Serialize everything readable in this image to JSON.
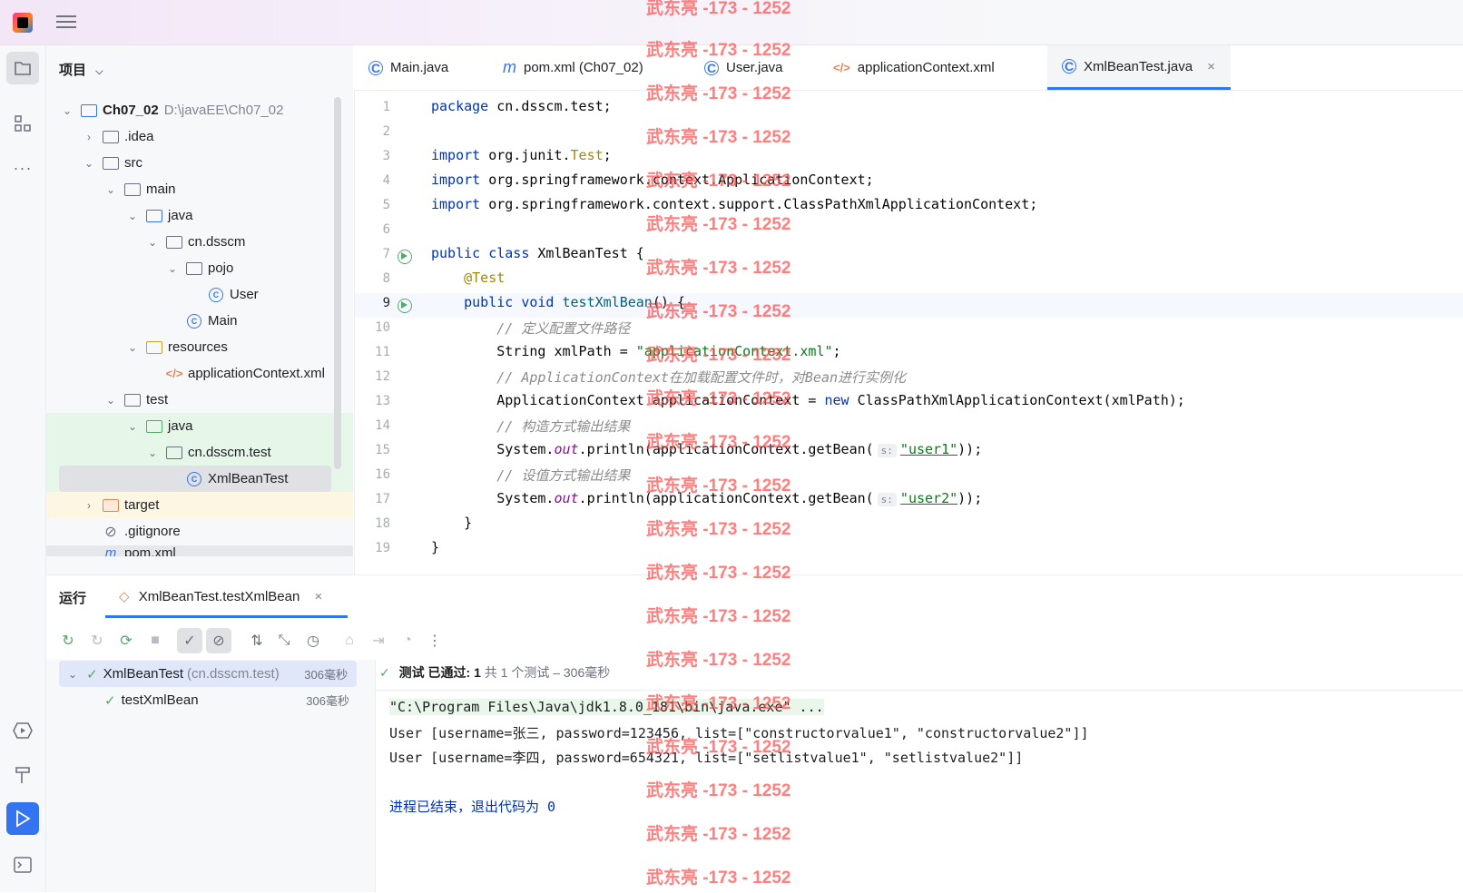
{
  "project_panel": {
    "title": "项目"
  },
  "tree": [
    {
      "label": "Ch07_02",
      "path": "D:\\javaEE\\Ch07_02"
    },
    {
      "label": ".idea"
    },
    {
      "label": "src"
    },
    {
      "label": "main"
    },
    {
      "label": "java"
    },
    {
      "label": "cn.dsscm"
    },
    {
      "label": "pojo"
    },
    {
      "label": "User"
    },
    {
      "label": "Main"
    },
    {
      "label": "resources"
    },
    {
      "label": "applicationContext.xml"
    },
    {
      "label": "test"
    },
    {
      "label": "java"
    },
    {
      "label": "cn.dsscm.test"
    },
    {
      "label": "XmlBeanTest"
    },
    {
      "label": "target"
    },
    {
      "label": ".gitignore"
    },
    {
      "label": "pom.xml"
    }
  ],
  "tabs": [
    "Main.java",
    "pom.xml (Ch07_02)",
    "User.java",
    "applicationContext.xml",
    "XmlBeanTest.java"
  ],
  "editor": {
    "line_numbers": [
      "1",
      "2",
      "3",
      "4",
      "5",
      "6",
      "7",
      "8",
      "9",
      "10",
      "11",
      "12",
      "13",
      "14",
      "15",
      "16",
      "17",
      "18",
      "19"
    ],
    "param_hint": "s:",
    "lines": {
      "l1_kw": "package",
      "l1": " cn.dsscm.test;",
      "l3_kw": "import",
      "l3": " org.junit.",
      "l3_an": "Test",
      "l3_end": ";",
      "l4_kw": "import",
      "l4": " org.springframework.context.ApplicationContext;",
      "l5_kw": "import",
      "l5": " org.springframework.context.support.ClassPathXmlApplicationContext;",
      "l7_kw": "public class",
      "l7": " XmlBeanTest {",
      "l8": "    @Test",
      "l9_kw": "    public void",
      "l9_fn": " testXmlBean",
      "l9": "() {",
      "l10": "        // 定义配置文件路径",
      "l11": "        String xmlPath = ",
      "l11_str": "\"applicationContext.xml\"",
      "l11_end": ";",
      "l12": "        // ApplicationContext在加载配置文件时，对Bean进行实例化",
      "l13": "        ApplicationContext applicationContext = ",
      "l13_kw": "new",
      "l13_end": " ClassPathXmlApplicationContext(xmlPath);",
      "l14": "        // 构造方式输出结果",
      "l15": "        System.",
      "l15_it": "out",
      "l15_mid": ".println(applicationContext.getBean(",
      "l15_str": "\"user1\"",
      "l15_end": "));",
      "l16": "        // 设值方式输出结果",
      "l17": "        System.",
      "l17_it": "out",
      "l17_mid": ".println(applicationContext.getBean(",
      "l17_str": "\"user2\"",
      "l17_end": "));",
      "l18": "    }",
      "l19": "}"
    }
  },
  "run": {
    "header": "运行",
    "tab": "XmlBeanTest.testXmlBean",
    "tests": [
      {
        "name": "XmlBeanTest",
        "pkg": "(cn.dsscm.test)",
        "dur": "306毫秒"
      },
      {
        "name": "testXmlBean",
        "dur": "306毫秒"
      }
    ],
    "status_bold": "测试 已通过: 1",
    "status_rest": "共 1 个测试 – 306毫秒",
    "console": [
      "\"C:\\Program Files\\Java\\jdk1.8.0_181\\bin\\java.exe\" ...",
      "User [username=张三, password=123456, list=[\"constructorvalue1\", \"constructorvalue2\"]]",
      "User [username=李四, password=654321, list=[\"setlistvalue1\", \"setlistvalue2\"]]",
      "",
      "进程已结束，退出代码为 0"
    ]
  },
  "watermark": "武东亮 -173 - 1252"
}
